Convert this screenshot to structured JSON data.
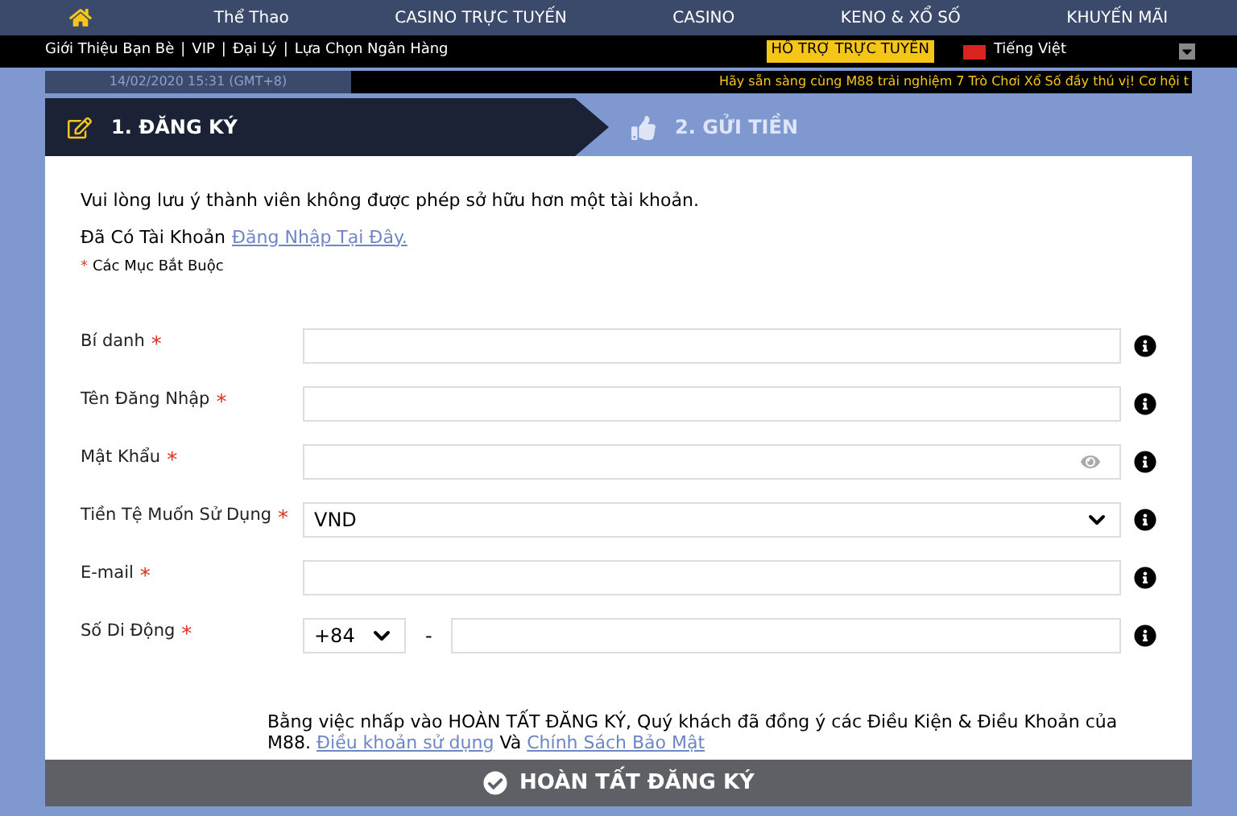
{
  "top_nav": [
    {
      "label": "Thể Thao"
    },
    {
      "label": "CASINO TRỰC TUYẾN"
    },
    {
      "label": "CASINO"
    },
    {
      "label": "KENO & XỔ SỐ"
    },
    {
      "label": "KHUYẾN MÃI"
    }
  ],
  "sub_nav": {
    "links": [
      "Giới Thiệu Bạn Bè",
      "VIP",
      "Đại Lý",
      "Lựa Chọn Ngân Hàng"
    ],
    "separator": "|",
    "support": "HỖ TRỢ TRỰC TUYẾN",
    "language": "Tiếng Việt"
  },
  "info_bar": {
    "datetime": "14/02/2020 15:31 (GMT+8)",
    "ticker": "Hãy sẵn sàng cùng M88 trải nghiệm 7 Trò Chơi Xổ Số đầy thú vị! Cơ hội t"
  },
  "steps": [
    {
      "label": "1. ĐĂNG KÝ",
      "selected": true
    },
    {
      "label": "2. GỬI TIỀN",
      "selected": false
    }
  ],
  "notice": "Vui lòng lưu ý thành viên không được phép sở hữu hơn một tài khoản.",
  "login_prompt": {
    "text": "Đã Có Tài Khoản",
    "link": "Đăng Nhập Tại Đây."
  },
  "required_note": {
    "mark": "*",
    "text": "Các Mục Bắt Buộc"
  },
  "fields": [
    {
      "kind": "text",
      "label": "Bí danh",
      "required_mark": "*"
    },
    {
      "kind": "text",
      "label": "Tên Đăng Nhập",
      "required_mark": "*"
    },
    {
      "kind": "password",
      "label": "Mật Khẩu",
      "required_mark": "*"
    },
    {
      "kind": "select",
      "label": "Tiền Tệ Muốn Sử Dụng",
      "required_mark": "*",
      "value": "VND"
    },
    {
      "kind": "text",
      "label": "E-mail",
      "required_mark": "*"
    },
    {
      "kind": "phone",
      "label": "Số Di Động",
      "required_mark": "*",
      "value": "+84",
      "separator": "-"
    }
  ],
  "terms": {
    "text": "Bằng việc nhấp vào HOÀN TẤT ĐĂNG KÝ, Quý khách đã đồng ý các Điều Kiện & Điều Khoản của M88.",
    "link_1": "Điều khoản sử dụng",
    "joiner": "Và",
    "link_2": "Chính Sách Bảo Mật"
  },
  "submit_button": "HOÀN TẤT ĐĂNG KÝ"
}
